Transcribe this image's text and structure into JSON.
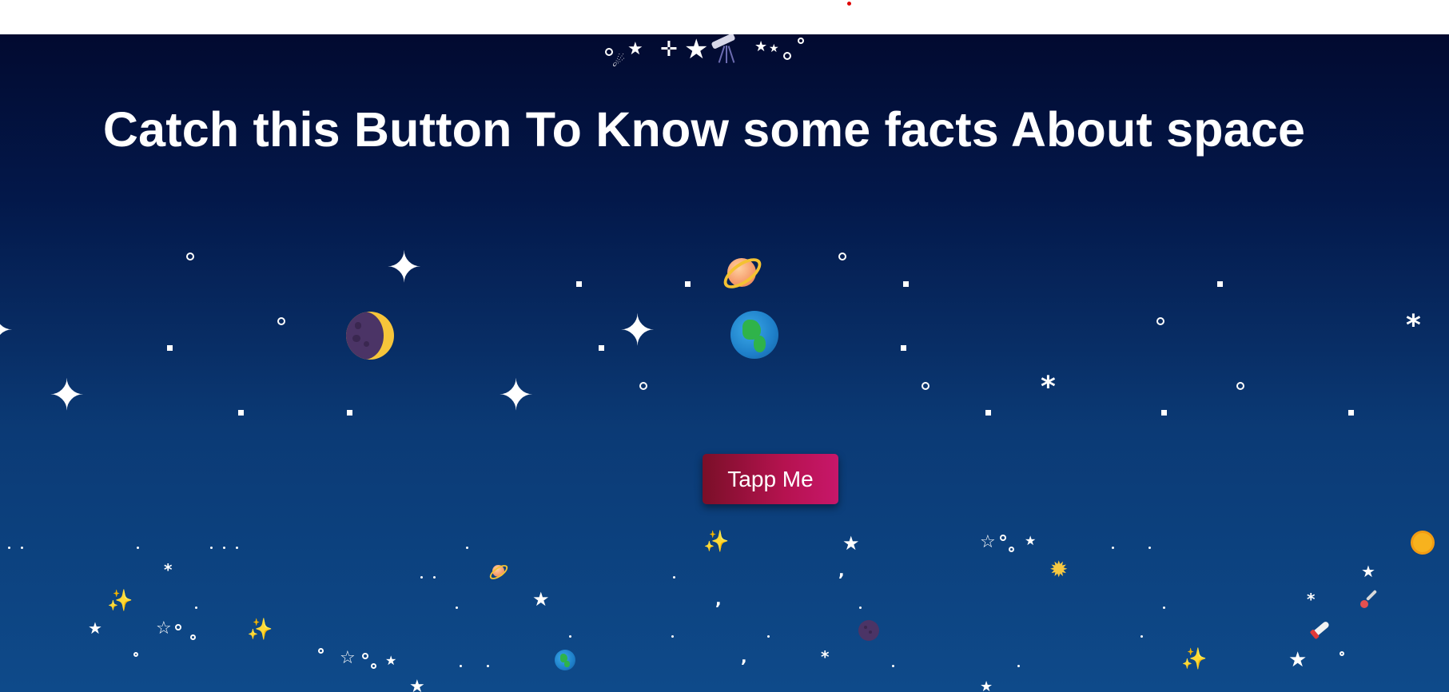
{
  "page": {
    "headline": "Catch this Button To Know some facts About space",
    "button_label": "Tapp Me"
  },
  "colors": {
    "background_top": "#020a30",
    "background_bottom": "#0e4a8a",
    "button_start": "#7a0f28",
    "button_end": "#c8176a",
    "text": "#ffffff"
  },
  "icons": {
    "planets": [
      "moon-icon",
      "saturn-icon",
      "earth-icon",
      "sun-icon"
    ],
    "decor": [
      "four-point-star-icon",
      "star-icon",
      "sparkles-icon",
      "rocket-icon",
      "comet-icon",
      "telescope-icon",
      "satellite-icon"
    ]
  }
}
